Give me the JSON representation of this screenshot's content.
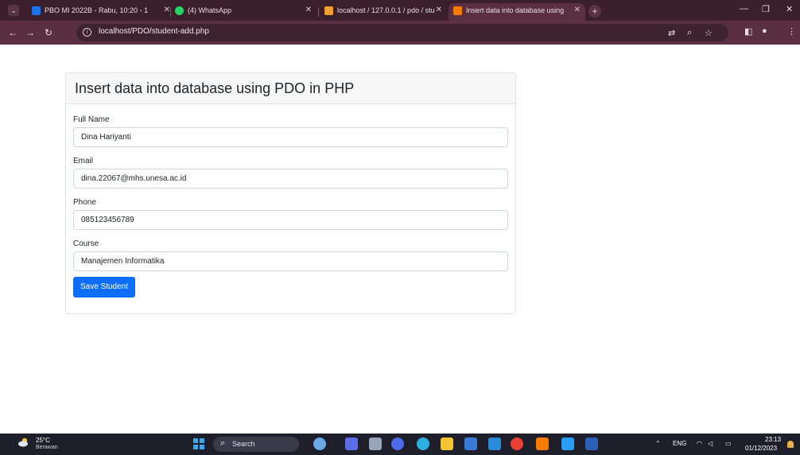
{
  "browser": {
    "tabs": [
      {
        "title": "PBO MI 2022B - Rabu, 10:20 - 1",
        "favicon_color": "#1a73e8",
        "active": false
      },
      {
        "title": "(4) WhatsApp",
        "favicon_color": "#25d366",
        "active": false
      },
      {
        "title": "localhost / 127.0.0.1 / pdo / stu",
        "favicon_color": "#f0a030",
        "active": false
      },
      {
        "title": "Insert data into database using",
        "favicon_color": "#f57c00",
        "active": true
      }
    ],
    "url": "localhost/PDO/student-add.php"
  },
  "page": {
    "title": "Insert data into database using PDO in PHP",
    "fields": [
      {
        "label": "Full Name",
        "value": "Dina Hariyanti"
      },
      {
        "label": "Email",
        "value": "dina.22067@mhs.unesa.ac.id"
      },
      {
        "label": "Phone",
        "value": "085123456789"
      },
      {
        "label": "Course",
        "value": "Manajemen Informatika"
      }
    ],
    "submit_label": "Save Student",
    "accent_color": "#0d6efd"
  },
  "taskbar": {
    "weather_temp": "25°C",
    "weather_desc": "Berawan",
    "search_label": "Search",
    "lang": "ENG",
    "time": "23:13",
    "date": "01/12/2023"
  }
}
